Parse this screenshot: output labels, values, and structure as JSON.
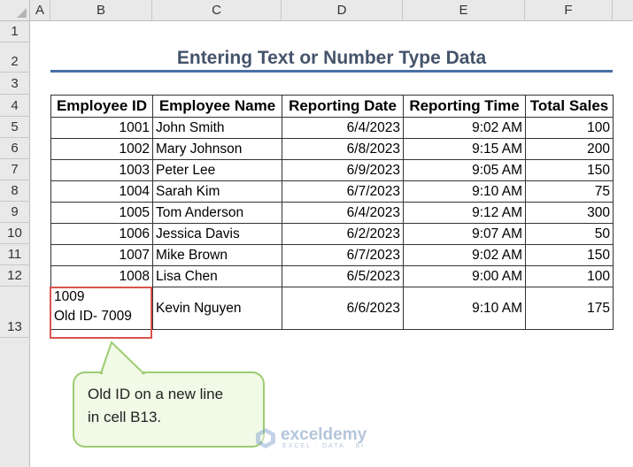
{
  "columns": [
    "A",
    "B",
    "C",
    "D",
    "E",
    "F"
  ],
  "rows": [
    "1",
    "2",
    "3",
    "4",
    "5",
    "6",
    "7",
    "8",
    "9",
    "10",
    "11",
    "12",
    "13"
  ],
  "title": "Entering Text or Number Type Data",
  "headers": [
    "Employee ID",
    "Employee Name",
    "Reporting Date",
    "Reporting Time",
    "Total Sales"
  ],
  "table_rows": [
    {
      "id": "1001",
      "name": "John Smith",
      "date": "6/4/2023",
      "time": "9:02 AM",
      "sales": "100"
    },
    {
      "id": "1002",
      "name": "Mary Johnson",
      "date": "6/8/2023",
      "time": "9:15 AM",
      "sales": "200"
    },
    {
      "id": "1003",
      "name": "Peter Lee",
      "date": "6/9/2023",
      "time": "9:05 AM",
      "sales": "150"
    },
    {
      "id": "1004",
      "name": "Sarah Kim",
      "date": "6/7/2023",
      "time": "9:10 AM",
      "sales": "75"
    },
    {
      "id": "1005",
      "name": "Tom Anderson",
      "date": "6/4/2023",
      "time": "9:12 AM",
      "sales": "300"
    },
    {
      "id": "1006",
      "name": "Jessica Davis",
      "date": "6/2/2023",
      "time": "9:07 AM",
      "sales": "50"
    },
    {
      "id": "1007",
      "name": "Mike Brown",
      "date": "6/7/2023",
      "time": "9:02 AM",
      "sales": "150"
    },
    {
      "id": "1008",
      "name": "Lisa Chen",
      "date": "6/5/2023",
      "time": "9:00 AM",
      "sales": "100"
    }
  ],
  "row13": {
    "id_line1": "1009",
    "id_line2": "Old ID- 7009",
    "name": "Kevin Nguyen",
    "date": "6/6/2023",
    "time": "9:10 AM",
    "sales": "175"
  },
  "callout": {
    "line1": "Old ID on a new line",
    "line2": "in cell B13."
  },
  "watermark": {
    "name": "exceldemy",
    "tagline": "EXCEL · DATA · BI"
  },
  "colors": {
    "title": "#44546a",
    "rule": "#4a6fa5",
    "selection": "#d9534f",
    "callout_fill": "#f1f9e7",
    "callout_border": "#9ccc72"
  }
}
